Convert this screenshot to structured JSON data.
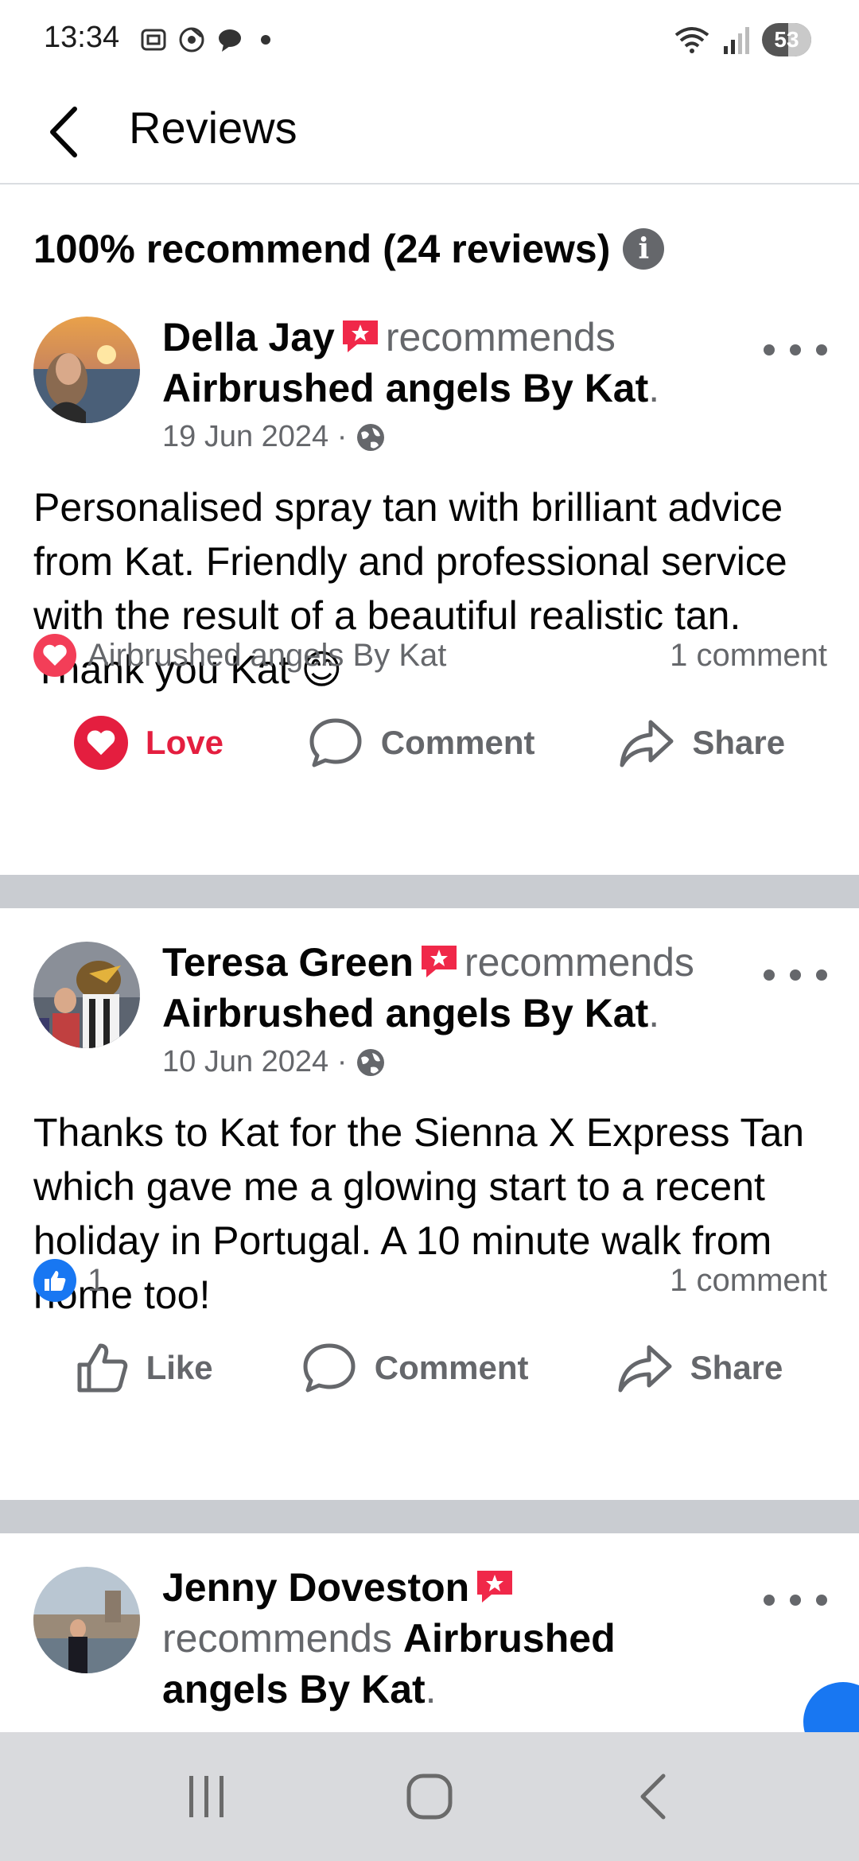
{
  "status_bar": {
    "time": "13:34",
    "battery": "53",
    "battery_level_pct": 53,
    "icons": [
      "screenshot-icon",
      "chrome-icon",
      "chat-icon",
      "dot-icon",
      "wifi-icon",
      "signal-icon"
    ]
  },
  "header": {
    "title": "Reviews"
  },
  "summary": {
    "text": "100% recommend (24 reviews)",
    "info_symbol": "i"
  },
  "reviews": [
    {
      "name": "Della Jay",
      "verb": "recommends",
      "page": "Airbrushed angels By Kat",
      "date": "19 Jun 2024 ·",
      "text": "Personalised spray tan with brilliant advice from Kat. Friendly and professional service with the result of a beautiful realistic tan. Thank you Kat 😊",
      "reaction_label": "Airbrushed angels By Kat",
      "comments": "1 comment",
      "actions": [
        "Love",
        "Comment",
        "Share"
      ]
    },
    {
      "name": "Teresa Green",
      "verb": "recommends",
      "page": "Airbrushed angels By Kat",
      "date": "10 Jun 2024 ·",
      "text": "Thanks to Kat for the Sienna X Express Tan which gave me a glowing start to a recent holiday in Portugal. A 10 minute walk from home too!",
      "reaction_label": "1",
      "comments": "1 comment",
      "actions": [
        "Like",
        "Comment",
        "Share"
      ]
    },
    {
      "name": "Jenny Doveston",
      "verb": "recommends",
      "page": "Airbrushed angels By Kat"
    }
  ],
  "colors": {
    "love": "#e41e3f",
    "like": "#1877f2",
    "secondary_text": "#65676b",
    "separator": "#c9ccd1",
    "badge": "#f02849"
  }
}
